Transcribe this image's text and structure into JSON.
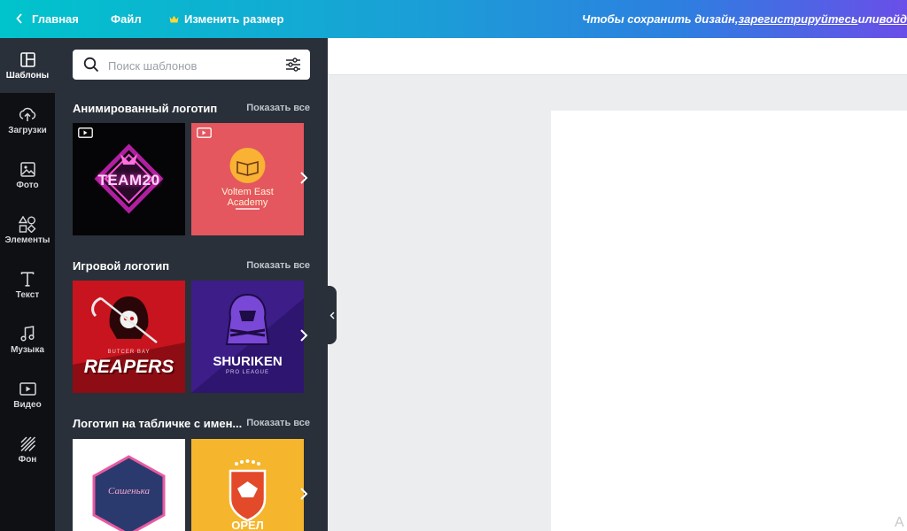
{
  "topbar": {
    "home_label": "Главная",
    "file_label": "Файл",
    "resize_label": "Изменить размер",
    "save_prefix": "Чтобы сохранить дизайн, ",
    "register_link": "зарегистрируйтесь",
    "or_text": " или ",
    "login_link": "войд"
  },
  "rail": {
    "items": [
      {
        "label": "Шаблоны",
        "icon": "templates-icon"
      },
      {
        "label": "Загрузки",
        "icon": "upload-icon"
      },
      {
        "label": "Фото",
        "icon": "photo-icon"
      },
      {
        "label": "Элементы",
        "icon": "elements-icon"
      },
      {
        "label": "Текст",
        "icon": "text-icon"
      },
      {
        "label": "Музыка",
        "icon": "music-icon"
      },
      {
        "label": "Видео",
        "icon": "video-icon"
      },
      {
        "label": "Фон",
        "icon": "background-icon"
      }
    ]
  },
  "search": {
    "placeholder": "Поиск шаблонов"
  },
  "sections": [
    {
      "title": "Анимированный логотип",
      "show_all": "Показать все",
      "cards": [
        {
          "text": "TEAM20"
        },
        {
          "text_line1": "Voltem East",
          "text_line2": "Academy"
        }
      ]
    },
    {
      "title": "Игровой логотип",
      "show_all": "Показать все",
      "cards": [
        {
          "text_small": "BUTCER BAY",
          "text": "REAPERS"
        },
        {
          "text": "SHURIKEN",
          "text_small": "PRO LEAGUE"
        }
      ]
    },
    {
      "title": "Логотип на табличке с имен...",
      "show_all": "Показать все",
      "cards": [
        {
          "text": "Сашенька"
        },
        {
          "text": "ОРЕЛ"
        }
      ]
    }
  ],
  "canvas": {
    "corner_text": "A"
  },
  "colors": {
    "panel": "#293039",
    "rail": "#0f1014",
    "accent_cyan": "#00c4cc",
    "accent_purple": "#6a4ee8"
  }
}
